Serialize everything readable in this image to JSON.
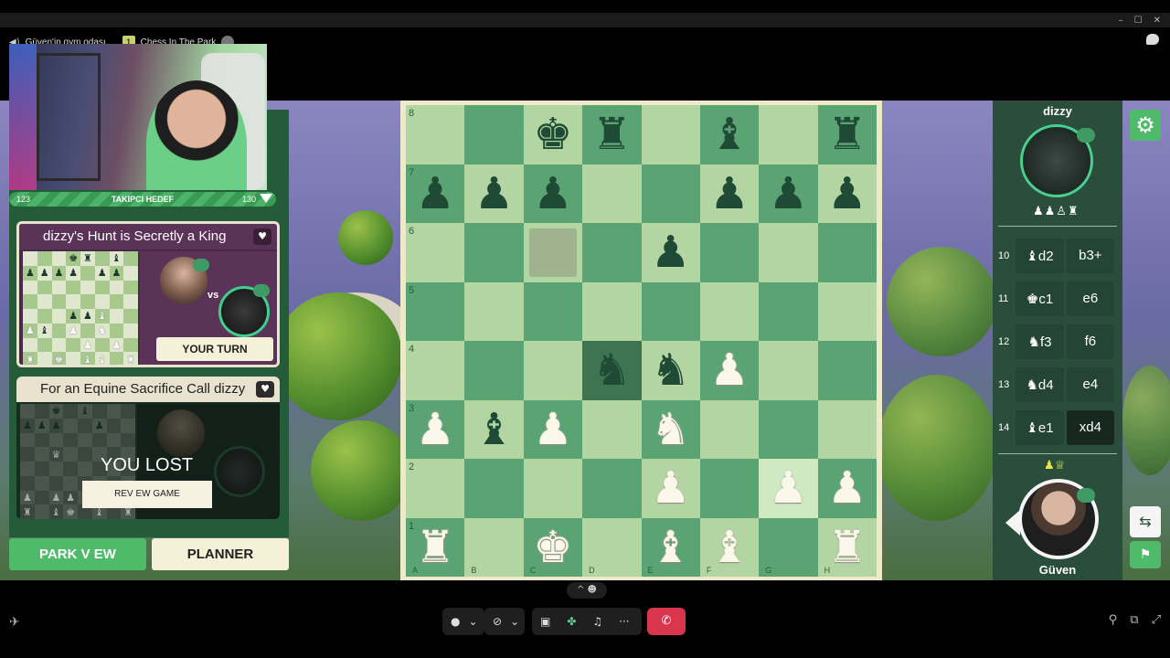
{
  "window": {
    "minimize": "–",
    "maximize": "☐",
    "close": "✕"
  },
  "vc": {
    "volume_icon": "◀)",
    "channel": "Güven'in gym odası",
    "activity_badge": "1",
    "activity": "Chess In The Park"
  },
  "left": {
    "progress_min": "123",
    "progress_label": "TAKIPCI HEDEF",
    "progress_max": "130",
    "card1": {
      "title": "dizzy's Hunt is Secretly a King",
      "vs": "vs",
      "button": "YOUR TURN",
      "favorite": "♥"
    },
    "card2": {
      "title": "For an Equine Sacrifice Call dizzy",
      "status": "YOU LOST",
      "button": "REV EW GAME",
      "favorite": "♥"
    },
    "park_button": "PARK V EW",
    "planner_button": "PLANNER"
  },
  "board": {
    "ranks": [
      "8",
      "7",
      "6",
      "5",
      "4",
      "3",
      "2",
      "1"
    ],
    "files": [
      "A",
      "B",
      "C",
      "D",
      "E",
      "F",
      "G",
      "H"
    ]
  },
  "right": {
    "opponent_name": "dizzy",
    "captured_by_opponent": "♟♟♙♜",
    "my_name": "Güven",
    "captured_by_me": "♟♕",
    "moves": [
      {
        "num": "10",
        "white": "♝d2",
        "black": "b3+"
      },
      {
        "num": "11",
        "white": "♚c1",
        "black": "e6"
      },
      {
        "num": "12",
        "white": "♞f3",
        "black": "f6"
      },
      {
        "num": "13",
        "white": "♞d4",
        "black": "e4"
      },
      {
        "num": "14",
        "white": "♝e1",
        "black": "xd4"
      }
    ]
  },
  "toolbar": {
    "expand": "^ ☻",
    "mic": "🎤",
    "cam": "⊘",
    "more": "···",
    "leave": "✆"
  }
}
